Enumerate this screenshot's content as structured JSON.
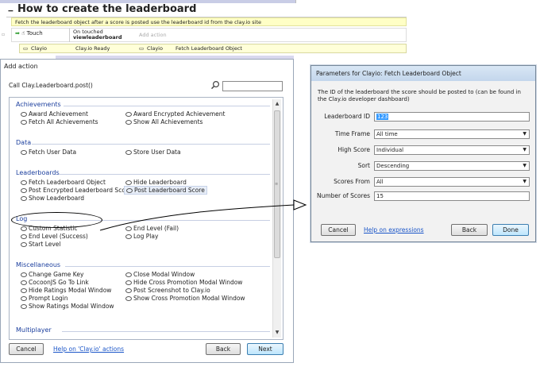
{
  "sheet": {
    "title": "How to create the leaderboard",
    "collapse_symbol": "−",
    "comment": "Fetch the leaderboard object after a score is posted use the leaderboard id from the clay.io site",
    "event1_object": "Touch",
    "event1_cond_line1": "On touched",
    "event1_cond_line2": "viewleaderboard",
    "event1_add_action": "Add action",
    "event2_object": "Clayio",
    "event2_condition": "Clay.io Ready",
    "event2_action_object": "Clayio",
    "event2_action": "Fetch Leaderboard Object"
  },
  "add_action": {
    "title": "Add action",
    "subtitle": "Call Clay.Leaderboard.post()",
    "search_value": "",
    "categories": {
      "achievements": "Achievements",
      "data": "Data",
      "leaderboards": "Leaderboards",
      "log": "Log",
      "misc": "Miscellaneous",
      "multiplayer": "Multiplayer"
    },
    "items": {
      "award_achievement": "Award Achievement",
      "award_encrypted_achievement": "Award Encrypted Achievement",
      "fetch_all_achievements": "Fetch All Achievements",
      "show_all_achievements": "Show All Achievements",
      "fetch_user_data": "Fetch User Data",
      "store_user_data": "Store User Data",
      "fetch_leaderboard_object": "Fetch Leaderboard Object",
      "hide_leaderboard": "Hide Leaderboard",
      "post_encrypted_leaderboard_score": "Post Encrypted Leaderboard Score",
      "post_leaderboard_score": "Post Leaderboard Score",
      "show_leaderboard": "Show Leaderboard",
      "custom_statistic": "Custom Statistic",
      "end_level_fail": "End Level (Fail)",
      "end_level_success": "End Level (Success)",
      "log_play": "Log Play",
      "start_level": "Start Level",
      "change_game_key": "Change Game Key",
      "close_modal_window": "Close Modal Window",
      "cocoonjs_go_to_link": "CocoonJS Go To Link",
      "hide_cross_promotion": "Hide Cross Promotion Modal Window",
      "hide_ratings_modal": "Hide Ratings Modal Window",
      "post_screenshot": "Post Screenshot to Clay.io",
      "prompt_login": "Prompt Login",
      "show_cross_promotion": "Show Cross Promotion Modal Window",
      "show_ratings_modal": "Show Ratings Modal Window"
    },
    "cancel_label": "Cancel",
    "help_link": "Help on 'Clay.io' actions",
    "back_label": "Back",
    "next_label": "Next"
  },
  "params": {
    "title": "Parameters for Clayio: Fetch Leaderboard Object",
    "description": "The ID of the leaderboard the score should be posted to (can be found in the Clay.io developer dashboard)",
    "leaderboard_id_label": "Leaderboard ID",
    "leaderboard_id_value": "123",
    "time_frame_label": "Time Frame",
    "time_frame_value": "All time",
    "high_score_label": "High Score",
    "high_score_value": "Individual",
    "sort_label": "Sort",
    "sort_value": "Descending",
    "scores_from_label": "Scores From",
    "scores_from_value": "All",
    "number_of_scores_label": "Number of Scores",
    "number_of_scores_value": "15",
    "cancel_label": "Cancel",
    "help_link": "Help on expressions",
    "back_label": "Back",
    "done_label": "Done"
  },
  "colors": {
    "category_blue": "#1c3f9e",
    "link_blue": "#1a55c8",
    "comment_yellow": "#ffffc6"
  }
}
